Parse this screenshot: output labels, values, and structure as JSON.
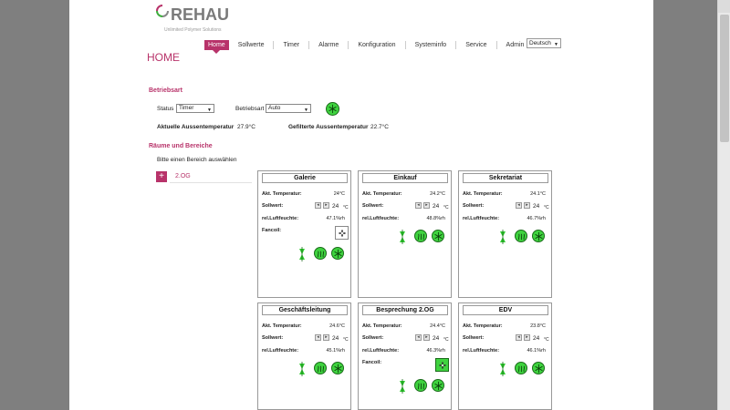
{
  "brand": {
    "name": "REHAU",
    "tagline": "Unlimited Polymer Solutions"
  },
  "nav": {
    "items": [
      {
        "label": "Home",
        "active": true
      },
      {
        "label": "Sollwerte"
      },
      {
        "label": "Timer"
      },
      {
        "label": "Alarme"
      },
      {
        "label": "Konfiguration"
      },
      {
        "label": "Systeminfo"
      },
      {
        "label": "Service"
      },
      {
        "label": "Admin"
      }
    ],
    "language": "Deutsch"
  },
  "page_title": "HOME",
  "betriebsart": {
    "title": "Betriebsart",
    "status_label": "Status",
    "status_value": "Timer",
    "mode_label": "Betriebsart",
    "mode_value": "Auto",
    "outdoor_temp_label": "Aktuelle Aussentemperatur",
    "outdoor_temp_value": "27.9°C",
    "filtered_temp_label": "Gefilterte Aussentemperatur",
    "filtered_temp_value": "22.7°C"
  },
  "areas": {
    "title": "Räume und Bereiche",
    "hint": "Bitte einen Bereich auswählen",
    "add_symbol": "+",
    "items": [
      "2.OG"
    ]
  },
  "labels": {
    "temp": "Akt. Temperatur:",
    "setpoint": "Sollwert:",
    "humidity": "rel.Luftfeuchte:",
    "fancoil": "Fancoil:",
    "unit": "°C",
    "spin_down": "◂",
    "spin_up": "▸"
  },
  "rooms": [
    {
      "name": "Galerie",
      "temp": "24°C",
      "setpoint": "24",
      "humidity": "47.1%rh"
    },
    {
      "name": "Einkauf",
      "temp": "24.2°C",
      "setpoint": "24",
      "humidity": "48.8%rh"
    },
    {
      "name": "Sekretariat",
      "temp": "24.1°C",
      "setpoint": "24",
      "humidity": "46.7%rh"
    },
    {
      "name": "Geschäftsleitung",
      "temp": "24.6°C",
      "setpoint": "24",
      "humidity": "45.1%rh"
    },
    {
      "name": "Besprechung 2.OG",
      "temp": "24.4°C",
      "setpoint": "24",
      "humidity": "46.3%rh"
    },
    {
      "name": "EDV",
      "temp": "23.8°C",
      "setpoint": "24",
      "humidity": "46.1%rh"
    }
  ],
  "colors": {
    "accent": "#b8336a",
    "status_green": "#3fd33f"
  },
  "icons": {
    "heating": "heating-wave-icon",
    "cooling": "snowflake-icon",
    "valve": "valve-icon",
    "fancoil": "fan-icon"
  }
}
